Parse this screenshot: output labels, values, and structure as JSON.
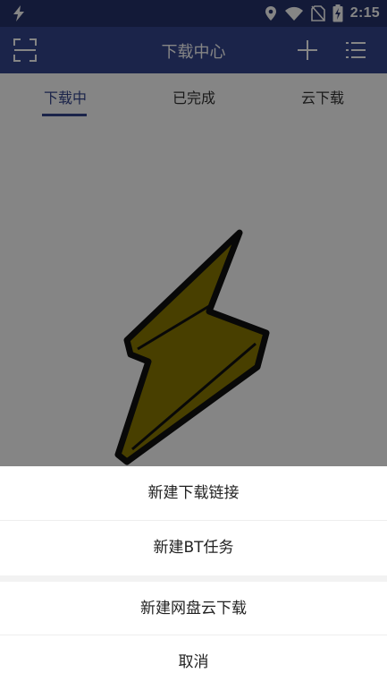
{
  "status_bar": {
    "time": "2:15",
    "icons": [
      "flash-icon",
      "location-icon",
      "wifi-icon",
      "no-sim-icon",
      "battery-charging-icon"
    ]
  },
  "app_bar": {
    "title": "下载中心",
    "icons": [
      "scan-icon",
      "add-icon",
      "list-icon"
    ]
  },
  "tabs": {
    "items": [
      {
        "label": "下载中"
      },
      {
        "label": "已完成"
      },
      {
        "label": "云下载"
      }
    ]
  },
  "empty_state": {
    "illustration": "lightning-bolt-icon"
  },
  "sheet": {
    "new_link_label": "新建下载链接",
    "new_bt_label": "新建BT任务",
    "new_cloud_label": "新建网盘云下载",
    "cancel_label": "取消"
  },
  "colors": {
    "status_bar": "#25336b",
    "app_bar": "#34458f",
    "accent": "#34458f",
    "bolt_fill": "#8a7a00"
  }
}
